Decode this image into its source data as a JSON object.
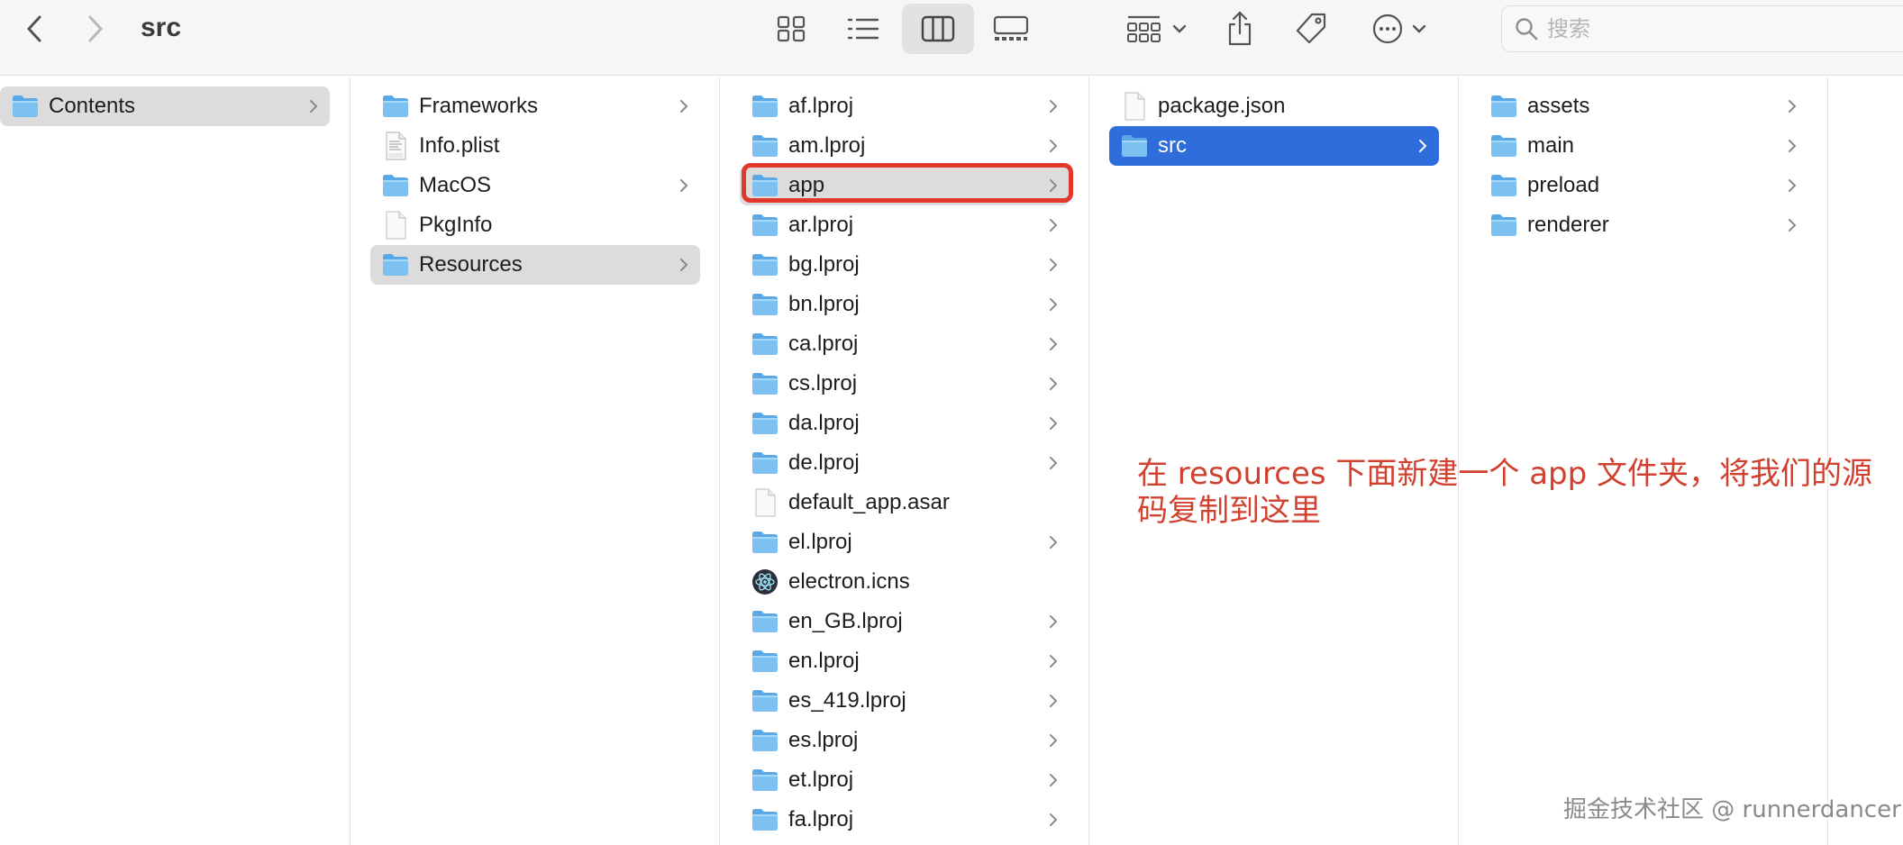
{
  "window": {
    "title": "src"
  },
  "search": {
    "placeholder": "搜索"
  },
  "colors": {
    "selection_blue": "#2e6ddb",
    "selection_grey": "#dcdcdc",
    "highlight_red": "#e2382b",
    "annotation_red": "#d0412f"
  },
  "columns": [
    {
      "items": [
        {
          "name": "Contents",
          "icon": "folder-icon",
          "chevron": true,
          "selected": "grey"
        }
      ]
    },
    {
      "items": [
        {
          "name": "Frameworks",
          "icon": "folder-icon",
          "chevron": true
        },
        {
          "name": "Info.plist",
          "icon": "plist-file-icon",
          "chevron": false
        },
        {
          "name": "MacOS",
          "icon": "folder-icon",
          "chevron": true
        },
        {
          "name": "PkgInfo",
          "icon": "document-icon",
          "chevron": false
        },
        {
          "name": "Resources",
          "icon": "folder-icon",
          "chevron": true,
          "selected": "grey"
        }
      ]
    },
    {
      "items": [
        {
          "name": "af.lproj",
          "icon": "folder-icon",
          "chevron": true
        },
        {
          "name": "am.lproj",
          "icon": "folder-icon",
          "chevron": true
        },
        {
          "name": "app",
          "icon": "folder-icon",
          "chevron": true,
          "selected": "grey",
          "highlighted": true
        },
        {
          "name": "ar.lproj",
          "icon": "folder-icon",
          "chevron": true
        },
        {
          "name": "bg.lproj",
          "icon": "folder-icon",
          "chevron": true
        },
        {
          "name": "bn.lproj",
          "icon": "folder-icon",
          "chevron": true
        },
        {
          "name": "ca.lproj",
          "icon": "folder-icon",
          "chevron": true
        },
        {
          "name": "cs.lproj",
          "icon": "folder-icon",
          "chevron": true
        },
        {
          "name": "da.lproj",
          "icon": "folder-icon",
          "chevron": true
        },
        {
          "name": "de.lproj",
          "icon": "folder-icon",
          "chevron": true
        },
        {
          "name": "default_app.asar",
          "icon": "document-icon",
          "chevron": false
        },
        {
          "name": "el.lproj",
          "icon": "folder-icon",
          "chevron": true
        },
        {
          "name": "electron.icns",
          "icon": "electron-icon",
          "chevron": false
        },
        {
          "name": "en_GB.lproj",
          "icon": "folder-icon",
          "chevron": true
        },
        {
          "name": "en.lproj",
          "icon": "folder-icon",
          "chevron": true
        },
        {
          "name": "es_419.lproj",
          "icon": "folder-icon",
          "chevron": true
        },
        {
          "name": "es.lproj",
          "icon": "folder-icon",
          "chevron": true
        },
        {
          "name": "et.lproj",
          "icon": "folder-icon",
          "chevron": true
        },
        {
          "name": "fa.lproj",
          "icon": "folder-icon",
          "chevron": true
        }
      ]
    },
    {
      "items": [
        {
          "name": "package.json",
          "icon": "document-icon",
          "chevron": false
        },
        {
          "name": "src",
          "icon": "folder-icon",
          "chevron": true,
          "selected": "blue"
        }
      ]
    },
    {
      "items": [
        {
          "name": "assets",
          "icon": "folder-icon",
          "chevron": true
        },
        {
          "name": "main",
          "icon": "folder-icon",
          "chevron": true
        },
        {
          "name": "preload",
          "icon": "folder-icon",
          "chevron": true
        },
        {
          "name": "renderer",
          "icon": "folder-icon",
          "chevron": true
        }
      ]
    }
  ],
  "annotation": {
    "text": "在 resources 下面新建一个 app 文件夹，将我们的源码复制到这里"
  },
  "watermark": {
    "text": "掘金技术社区 @ runnerdancer"
  }
}
